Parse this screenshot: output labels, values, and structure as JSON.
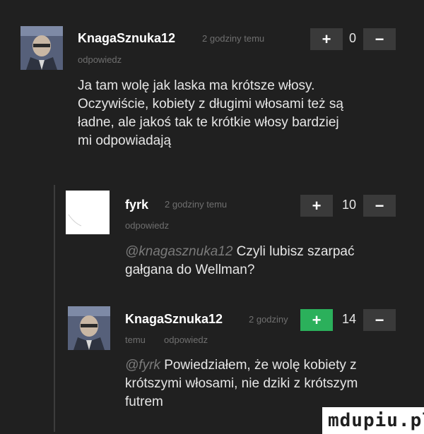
{
  "comments": [
    {
      "username": "KnagaSznuka12",
      "time": "2 godziny temu",
      "reply": "odpowiedz",
      "votes": "0",
      "text": "Ja tam wolę jak laska ma krótsze włosy. Oczywiście, kobiety z długimi włosami też są ładne, ale jakoś tak te krótkie włosy bardziej mi odpowiadają"
    },
    {
      "username": "fyrk",
      "time": "2 godziny temu",
      "reply": "odpowiedz",
      "votes": "10",
      "mention": "@knagasznuka12",
      "text": "Czyli lubisz szarpać gałgana do Wellman?"
    },
    {
      "username": "KnagaSznuka12",
      "time_part1": "2 godziny",
      "time_part2": "temu",
      "reply": "odpowiedz",
      "votes": "14",
      "mention": "@fyrk",
      "text": "Powiedziałem, że wolę kobiety z krótszymi włosami, nie dziki z krótszym futrem"
    }
  ],
  "vote": {
    "plus": "+",
    "minus": "−"
  },
  "watermark": "mdupiu.pl",
  "colors": {
    "background": "#202020",
    "upvote_active": "#2bb05b",
    "button": "#3a3a3a"
  }
}
